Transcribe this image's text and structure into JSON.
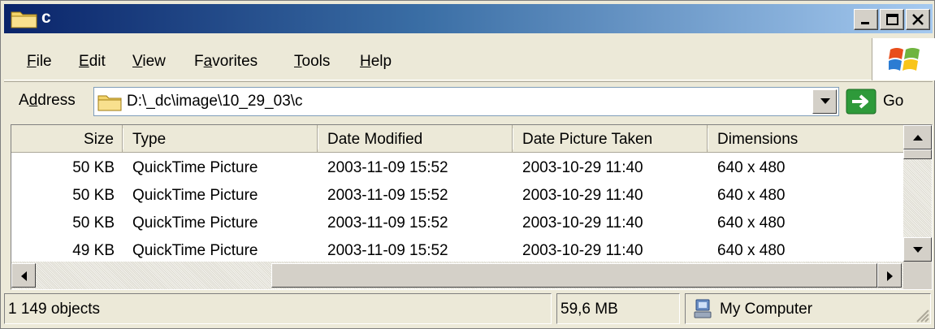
{
  "window": {
    "title": "c"
  },
  "menu": {
    "file": {
      "ul": "F",
      "rest": "ile"
    },
    "edit": {
      "ul": "E",
      "rest": "dit"
    },
    "view": {
      "ul": "V",
      "rest": "iew"
    },
    "favorites": {
      "pre": "F",
      "ul": "a",
      "rest": "vorites"
    },
    "tools": {
      "ul": "T",
      "rest": "ools"
    },
    "help": {
      "ul": "H",
      "rest": "elp"
    }
  },
  "address": {
    "label_pre": "A",
    "label_ul": "d",
    "label_rest": "dress",
    "path": "D:\\_dc\\image\\10_29_03\\c",
    "go_label": "Go"
  },
  "columns": {
    "size": "Size",
    "type": "Type",
    "date_modified": "Date Modified",
    "date_taken": "Date Picture Taken",
    "dimensions": "Dimensions"
  },
  "rows": [
    {
      "size": "50 KB",
      "type": "QuickTime Picture",
      "date_modified": "2003-11-09 15:52",
      "date_taken": "2003-10-29 11:40",
      "dimensions": "640 x 480"
    },
    {
      "size": "50 KB",
      "type": "QuickTime Picture",
      "date_modified": "2003-11-09 15:52",
      "date_taken": "2003-10-29 11:40",
      "dimensions": "640 x 480"
    },
    {
      "size": "50 KB",
      "type": "QuickTime Picture",
      "date_modified": "2003-11-09 15:52",
      "date_taken": "2003-10-29 11:40",
      "dimensions": "640 x 480"
    },
    {
      "size": "49 KB",
      "type": "QuickTime Picture",
      "date_modified": "2003-11-09 15:52",
      "date_taken": "2003-10-29 11:40",
      "dimensions": "640 x 480"
    }
  ],
  "status": {
    "objects": "1 149 objects",
    "total_size": "59,6 MB",
    "zone": "My Computer"
  },
  "icons": {
    "title": "folder-icon",
    "address": "folder-icon",
    "go": "go-arrow-icon",
    "zone": "my-computer-icon"
  },
  "colors": {
    "titlebar_start": "#0a246a",
    "titlebar_end": "#a6caf0",
    "face": "#ece9d8",
    "go_green": "#2e9a3a"
  }
}
